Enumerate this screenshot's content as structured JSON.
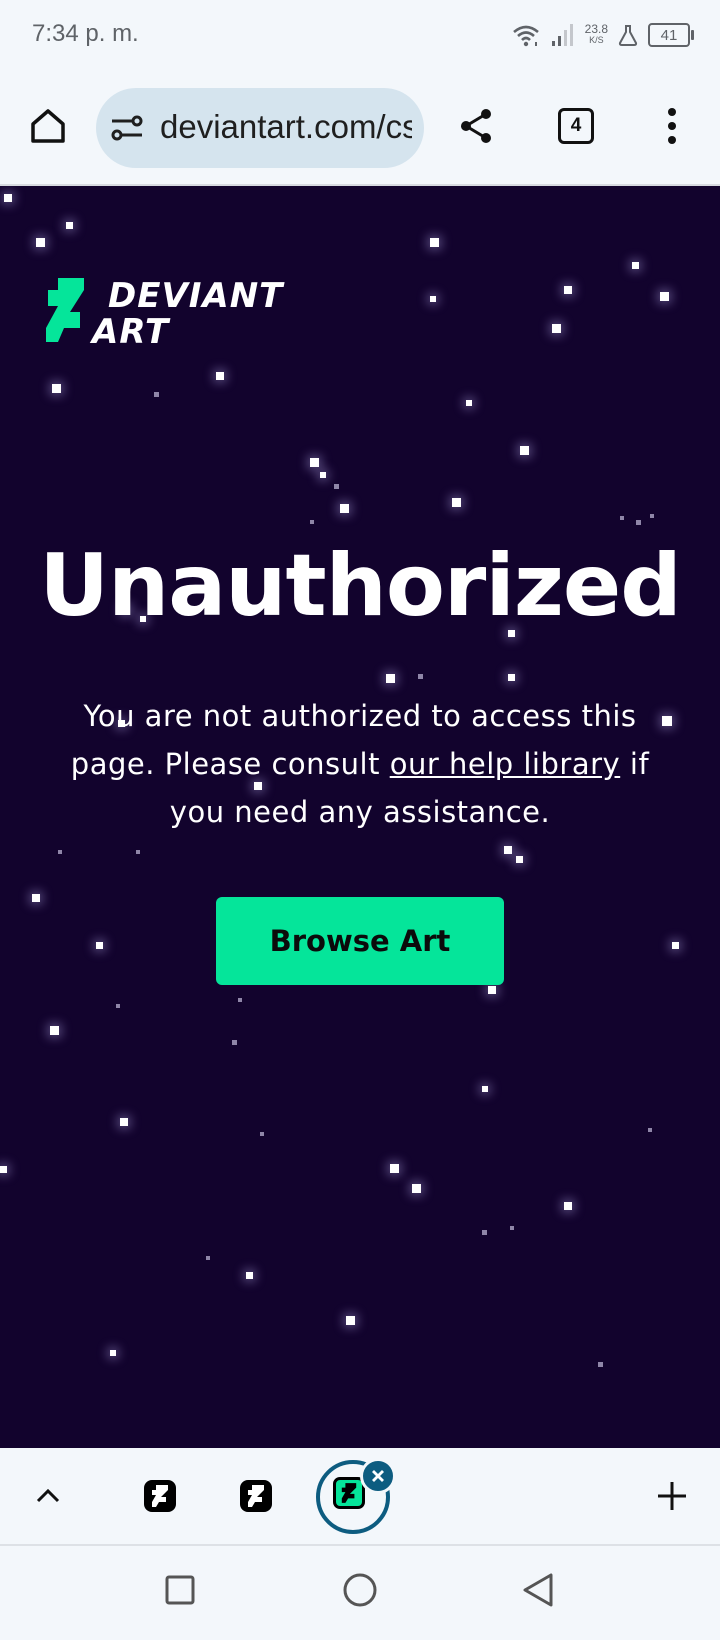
{
  "status_bar": {
    "time": "7:34 p. m.",
    "network_speed_value": "23.8",
    "network_speed_unit": "K/S",
    "battery_level": "41"
  },
  "browser_toolbar": {
    "url_text": "deviantart.com/cs",
    "tab_count": "4",
    "icons": [
      "home-icon",
      "site-settings-icon",
      "share-icon",
      "tab-switcher-icon",
      "more-options-icon"
    ]
  },
  "page": {
    "logo_text_line1": "DEVIANT",
    "logo_text_line2": "ART",
    "headline": "Unauthorized",
    "message_before_link": "You are not authorized to access this page. Please consult ",
    "message_link": "our help library",
    "message_after_link": " if you need any assistance.",
    "cta_label": "Browse Art",
    "colors": {
      "background": "#12032d",
      "brand_green": "#05e59a",
      "text": "#ffffff"
    }
  },
  "tab_strip": {
    "icons": [
      "collapse-chevron-icon",
      "tab-favicon-deviantart",
      "tab-favicon-deviantart",
      "active-tab-favicon-deviantart",
      "close-tab-icon",
      "new-tab-plus-icon"
    ],
    "accent_color": "#0d5c80"
  },
  "nav_bar": {
    "icons": [
      "recents-square-icon",
      "home-circle-icon",
      "back-triangle-icon"
    ]
  }
}
